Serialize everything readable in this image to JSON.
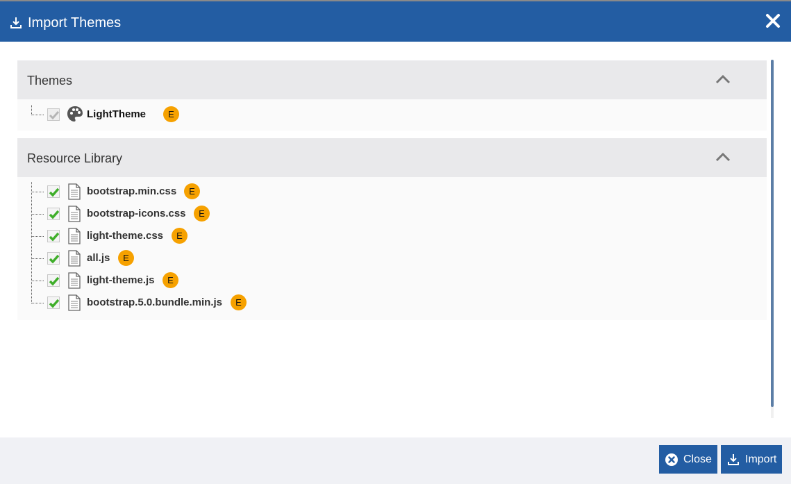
{
  "dialog": {
    "title": "Import Themes",
    "close_icon": "close-x-icon",
    "title_icon": "download-icon"
  },
  "sections": [
    {
      "title": "Themes",
      "collapse_icon": "chevron-up-icon",
      "items": [
        {
          "label": "LightTheme",
          "icon": "palette-icon",
          "checked": true,
          "disabled": true,
          "badge": "E"
        }
      ]
    },
    {
      "title": "Resource Library",
      "collapse_icon": "chevron-up-icon",
      "items": [
        {
          "label": "bootstrap.min.css",
          "icon": "file-icon",
          "checked": true,
          "badge": "E"
        },
        {
          "label": "bootstrap-icons.css",
          "icon": "file-icon",
          "checked": true,
          "badge": "E"
        },
        {
          "label": "light-theme.css",
          "icon": "file-icon",
          "checked": true,
          "badge": "E"
        },
        {
          "label": "all.js",
          "icon": "file-icon",
          "checked": true,
          "badge": "E"
        },
        {
          "label": "light-theme.js",
          "icon": "file-icon",
          "checked": true,
          "badge": "E"
        },
        {
          "label": "bootstrap.5.0.bundle.min.js",
          "icon": "file-icon",
          "checked": true,
          "badge": "E"
        }
      ]
    }
  ],
  "footer": {
    "close_label": "Close",
    "import_label": "Import"
  },
  "colors": {
    "primary": "#235da3",
    "badge": "#f6a100",
    "check": "#3fae2a"
  }
}
